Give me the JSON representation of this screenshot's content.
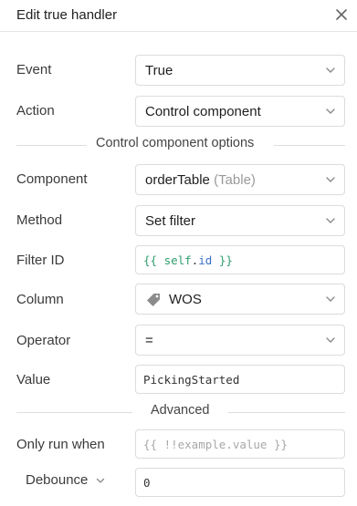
{
  "header": {
    "title": "Edit true handler",
    "close_icon": "close-icon"
  },
  "form": {
    "event": {
      "label": "Event",
      "value": "True"
    },
    "action": {
      "label": "Action",
      "value": "Control component"
    },
    "section_options": "Control component options",
    "component": {
      "label": "Component",
      "value": "orderTable",
      "type_hint": "(Table)"
    },
    "method": {
      "label": "Method",
      "value": "Set filter"
    },
    "filter_id": {
      "label": "Filter ID",
      "code": {
        "open": "{{",
        "obj": "self",
        "dot": ".",
        "prop": "id",
        "close": "}}"
      }
    },
    "column": {
      "label": "Column",
      "value": "WOS",
      "icon": "tag-icon"
    },
    "operator": {
      "label": "Operator",
      "value": "="
    },
    "value": {
      "label": "Value",
      "value": "PickingStarted"
    },
    "section_advanced": "Advanced",
    "only_run_when": {
      "label": "Only run when",
      "placeholder": "{{ !!example.value }}"
    },
    "debounce": {
      "label": "Debounce",
      "value": "0"
    }
  },
  "colors": {
    "accent_code_brace": "#2f9e6e",
    "accent_code_prop": "#3a70c9",
    "border": "#dcdcdc"
  }
}
